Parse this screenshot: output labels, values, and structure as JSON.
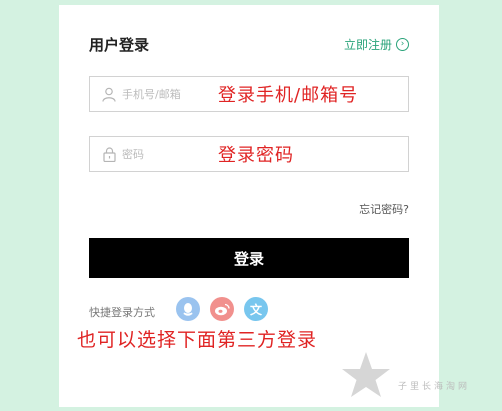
{
  "header": {
    "title": "用户登录",
    "register_label": "立即注册"
  },
  "form": {
    "account_placeholder": "手机号/邮箱",
    "password_placeholder": "密码",
    "forgot_label": "忘记密码?",
    "login_label": "登录"
  },
  "quick_login": {
    "label": "快捷登录方式",
    "icons": [
      "qq-icon",
      "weibo-icon",
      "wen-icon"
    ],
    "wen_glyph": "文"
  },
  "annotations": {
    "account": "登录手机/邮箱号",
    "password": "登录密码",
    "third_party": "也可以选择下面第三方登录"
  },
  "watermark": {
    "text": "子里长海淘网"
  },
  "colors": {
    "background": "#d4f2e1",
    "accent": "#2aa37a",
    "annotation": "#e02424",
    "button": "#000000"
  }
}
